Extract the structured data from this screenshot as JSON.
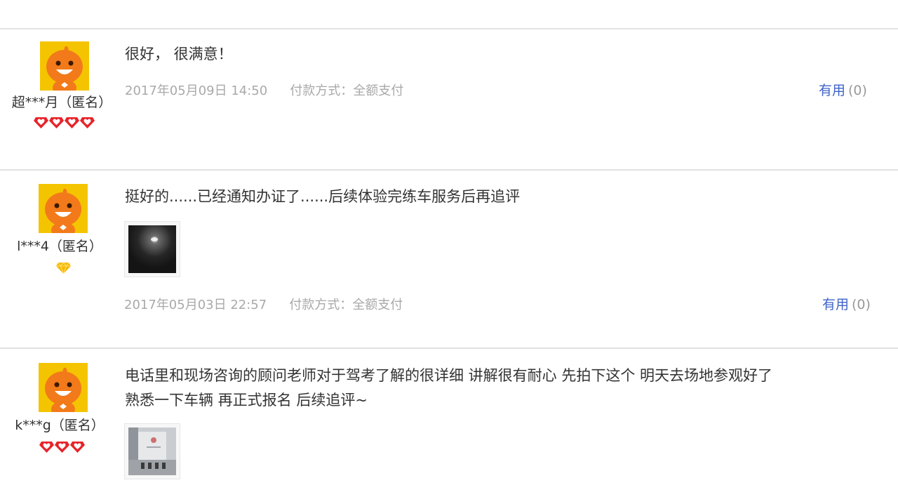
{
  "colors": {
    "avatar_bg": "#f5c400",
    "avatar_face": "#f27a1a",
    "useful_link": "#3f63c8",
    "meta_text": "#a9a9a9",
    "divider": "#e2e2e2"
  },
  "reviews": [
    {
      "username": "超***月（匿名）",
      "level_icon": "red-heart-diamond-icon",
      "level_count": 4,
      "text_lines": [
        "很好， 很满意！"
      ],
      "date": "2017年05月09日 14:50",
      "payment": "付款方式：全额支付",
      "useful_label": "有用",
      "useful_count": "(0)",
      "has_photo": false
    },
    {
      "username": "l***4（匿名）",
      "level_icon": "yellow-diamond-icon",
      "level_count": 1,
      "text_lines": [
        "挺好的......已经通知办证了......后续体验完练车服务后再追评"
      ],
      "date": "2017年05月03日 22:57",
      "payment": "付款方式：全额支付",
      "useful_label": "有用",
      "useful_count": "(0)",
      "has_photo": true
    },
    {
      "username": "k***g（匿名）",
      "level_icon": "red-heart-diamond-icon",
      "level_count": 3,
      "text_lines": [
        "电话里和现场咨询的顾问老师对于驾考了解的很详细 讲解很有耐心 先拍下这个 明天去场地参观好了",
        "熟悉一下车辆 再正式报名 后续追评~"
      ],
      "has_photo": true
    }
  ]
}
